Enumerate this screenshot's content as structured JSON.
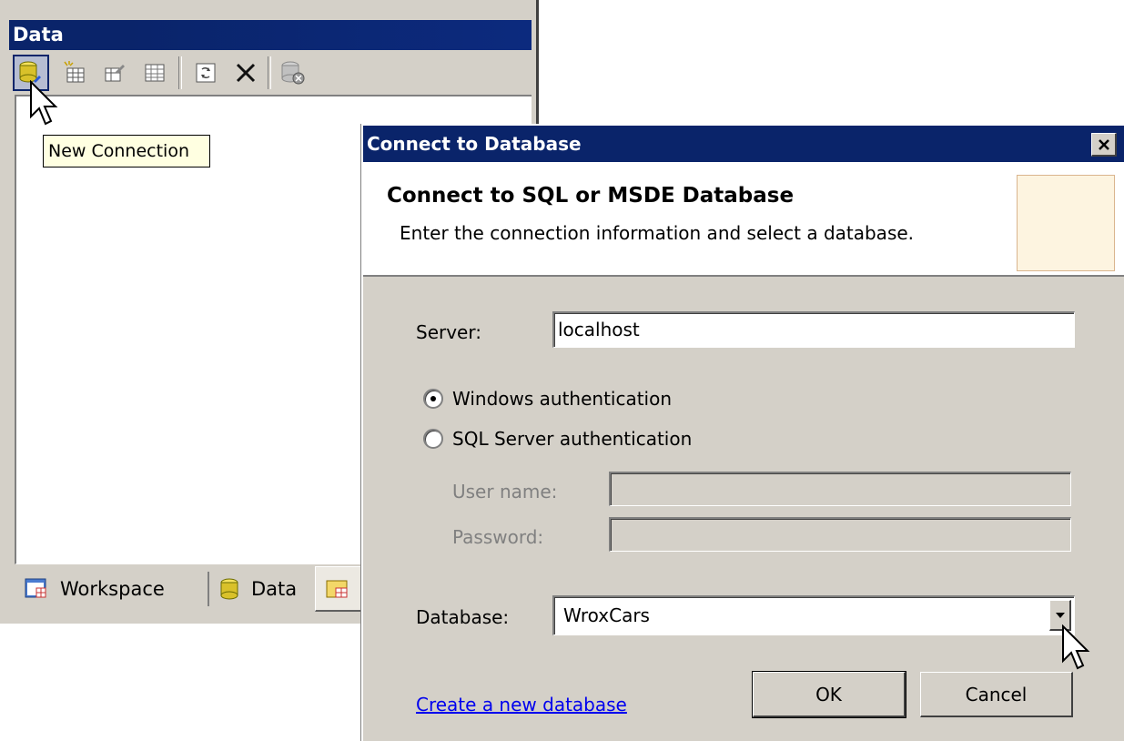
{
  "data_panel": {
    "title": "Data",
    "toolbar": [
      {
        "name": "new-connection-button",
        "icon": "database-new-icon"
      },
      {
        "name": "new-table-button",
        "icon": "table-new-icon"
      },
      {
        "name": "edit-button",
        "icon": "edit-icon"
      },
      {
        "name": "table-button",
        "icon": "table-icon"
      },
      {
        "name": "refresh-button",
        "icon": "refresh-icon"
      },
      {
        "name": "delete-button",
        "icon": "close-x-icon"
      },
      {
        "name": "disconnect-button",
        "icon": "database-disconnect-icon"
      }
    ],
    "tooltip": "New Connection",
    "tabs": [
      {
        "label": "Workspace",
        "icon": "workspace-icon"
      },
      {
        "label": "Data",
        "icon": "database-icon"
      },
      {
        "label": "",
        "icon": "components-icon"
      }
    ]
  },
  "dialog": {
    "title": "Connect to Database",
    "heading": "Connect to SQL or MSDE Database",
    "subheading": "Enter the connection information and select a database.",
    "server_label": "Server:",
    "server_value": "localhost",
    "auth_options": [
      {
        "label": "Windows authentication",
        "selected": true
      },
      {
        "label": "SQL Server authentication",
        "selected": false
      }
    ],
    "username_label": "User name:",
    "username_value": "",
    "password_label": "Password:",
    "password_value": "",
    "database_label": "Database:",
    "database_value": "WroxCars",
    "create_link": "Create a new database",
    "ok_label": "OK",
    "cancel_label": "Cancel"
  },
  "colors": {
    "titlebar": "#0a246a",
    "face": "#d4d0c8",
    "tooltip_bg": "#ffffe1",
    "link": "#0000ee"
  }
}
